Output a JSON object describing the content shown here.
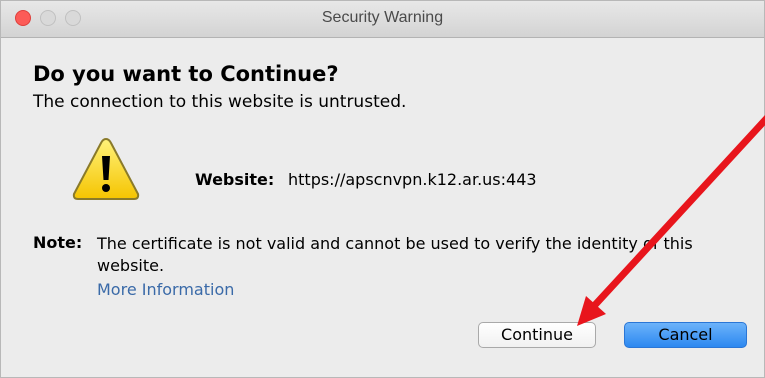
{
  "window": {
    "title": "Security Warning"
  },
  "dialog": {
    "heading": "Do you want to Continue?",
    "subheading": "The connection to this website is untrusted.",
    "website_label": "Website:",
    "website_url": "https://apscnvpn.k12.ar.us:443",
    "note_label": "Note:",
    "note_text": "The certificate is not valid and cannot be used to verify the identity of this website.",
    "more_info_link": "More Information"
  },
  "buttons": {
    "continue_label": "Continue",
    "cancel_label": "Cancel"
  },
  "icons": {
    "warning": "warning-triangle-icon",
    "annotation": "red-arrow-annotation"
  },
  "colors": {
    "close_button": "#fc5b57",
    "link": "#3a6aa8",
    "default_button": "#2c88f0",
    "annotation_arrow": "#e8151c",
    "warning_fill": "#ffe23a"
  }
}
